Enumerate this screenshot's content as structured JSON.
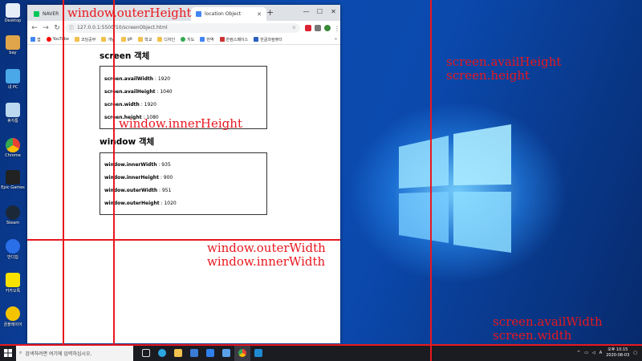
{
  "desktop": {
    "icons": [
      {
        "label": "Desktop",
        "icon": "file-icon",
        "color": "#e8eef7"
      },
      {
        "label": "bay",
        "icon": "folder-user-icon",
        "color": "#e0a54a"
      },
      {
        "label": "내 PC",
        "icon": "pc-icon",
        "color": "#4aa8e8"
      },
      {
        "label": "휴지통",
        "icon": "recycle-bin-icon",
        "color": "#bcd8f0"
      },
      {
        "label": "Chrome",
        "icon": "chrome-icon",
        "color": "#e94235"
      },
      {
        "label": "Epic Games",
        "icon": "epic-games-icon",
        "color": "#222222"
      },
      {
        "label": "Steam",
        "icon": "steam-icon",
        "color": "#1b2838"
      },
      {
        "label": "반디집",
        "icon": "bandizip-icon",
        "color": "#2a6ee8"
      },
      {
        "label": "카카오톡",
        "icon": "kakaotalk-icon",
        "color": "#f7e200"
      },
      {
        "label": "곰플레이어",
        "icon": "gomplayer-icon",
        "color": "#f5c400"
      }
    ]
  },
  "browser": {
    "tabs": [
      {
        "label": "NAVER",
        "color": "#03c75a"
      },
      {
        "label": "location Object",
        "color": "#4285f4"
      }
    ],
    "url": "127.0.0.1:5500/10/screenObject.html",
    "bookmarks": [
      "앱",
      "YouTube",
      "코딩공부",
      "개념",
      "git",
      "학교",
      "디자인",
      "지도",
      "번역",
      "한컴스페이스",
      "한글과컴퓨터"
    ],
    "window_controls": [
      "—",
      "☐",
      "✕"
    ]
  },
  "page": {
    "screen_heading": "screen 객체",
    "screen_rows": [
      {
        "key": "screen.availWidth",
        "value": " : 1920"
      },
      {
        "key": "screen.availHeight",
        "value": " : 1040"
      },
      {
        "key": "screen.width",
        "value": " : 1920"
      },
      {
        "key": "screen.height",
        "value": " : 1080"
      }
    ],
    "window_heading": "window 객체",
    "window_rows": [
      {
        "key": "window.innerWidth",
        "value": " : 935"
      },
      {
        "key": "window.innerHeight",
        "value": " : 900"
      },
      {
        "key": "window.outerWidth",
        "value": " : 951"
      },
      {
        "key": "window.outerHeight",
        "value": " : 1020"
      }
    ]
  },
  "annotations": {
    "outer_height": "window.outerHeight",
    "inner_height": "window.innerHeight",
    "avail_height": "screen.availHeight",
    "screen_height": "screen.height",
    "outer_width": "window.outerWidth",
    "inner_width": "window.innerWidth",
    "avail_width": "screen.availWidth",
    "screen_width": "screen.width",
    "color": "#e8181f"
  },
  "taskbar": {
    "search_placeholder": "검색하려면 여기에 입력하십시오.",
    "time_period": "오후",
    "time": "10:15",
    "date": "2020-08-03",
    "ime": "A"
  }
}
